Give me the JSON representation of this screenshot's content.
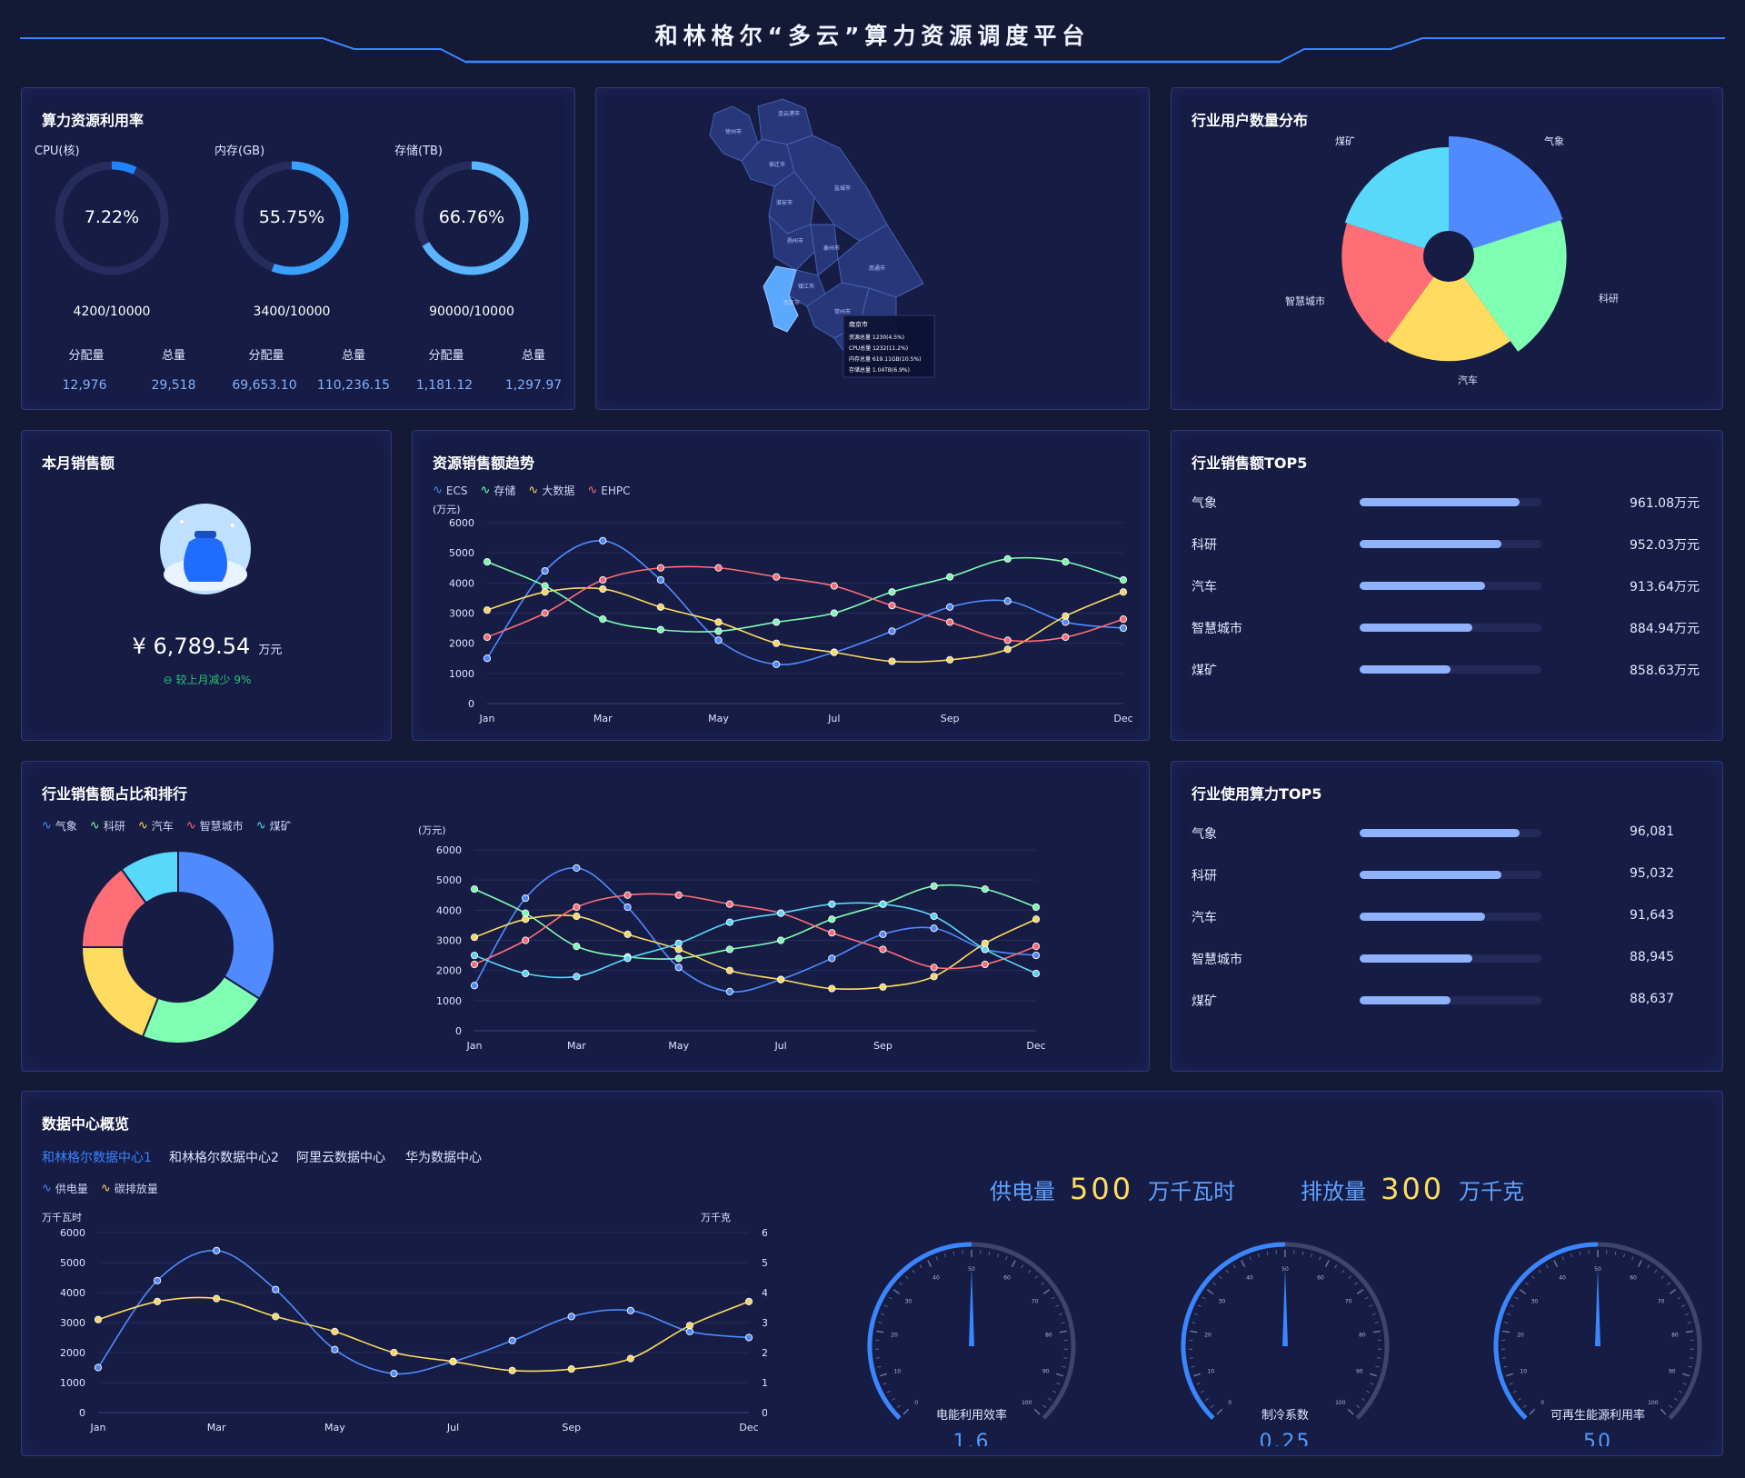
{
  "header": {
    "title": "和林格尔“多云”算力资源调度平台"
  },
  "utilization": {
    "title": "算力资源利用率",
    "items": [
      {
        "label": "CPU(核)",
        "percent": 7.22,
        "percent_text": "7.22%",
        "ratio": "4200/10000",
        "alloc_label": "分配量",
        "total_label": "总量",
        "alloc": "12,976",
        "total": "29,518"
      },
      {
        "label": "内存(GB)",
        "percent": 55.75,
        "percent_text": "55.75%",
        "ratio": "3400/10000",
        "alloc_label": "分配量",
        "total_label": "总量",
        "alloc": "69,653.10",
        "total": "110,236.15"
      },
      {
        "label": "存储(TB)",
        "percent": 66.76,
        "percent_text": "66.76%",
        "ratio": "90000/10000",
        "alloc_label": "分配量",
        "total_label": "总量",
        "alloc": "1,181.12",
        "total": "1,297.97"
      }
    ]
  },
  "map": {
    "cities": [
      "徐州市",
      "连云港市",
      "宿迁市",
      "淮安市",
      "盐城市",
      "扬州市",
      "泰州市",
      "南通市",
      "镇江市",
      "常州市",
      "南京市"
    ],
    "tooltip": {
      "city": "南京市",
      "lines": [
        "资源总量 1230(4.5%)",
        "CPU总量 1232(11.2%)",
        "内存总量 619.11GB(10.5%)",
        "存储总量 1.04TB(6.9%)"
      ]
    }
  },
  "industry_users": {
    "title": "行业用户数量分布",
    "labels": [
      "气象",
      "科研",
      "汽车",
      "智慧城市",
      "煤矿"
    ],
    "colors": {
      "气象": "#4f8bff",
      "科研": "#7effb2",
      "汽车": "#ffdc60",
      "智慧城市": "#ff6e76",
      "煤矿": "#58d9f9"
    }
  },
  "monthly_sales": {
    "title": "本月销售额",
    "amount": "¥ 6,789.54",
    "unit": "万元",
    "compare": "较上月减少 9%"
  },
  "trend": {
    "title": "资源销售额趋势",
    "unit": "(万元)",
    "legend": [
      "ECS",
      "存储",
      "大数据",
      "EHPC"
    ]
  },
  "top5_sales": {
    "title": "行业销售额TOP5",
    "rows": [
      {
        "name": "气象",
        "value": "961.08万元",
        "ratio": 0.88
      },
      {
        "name": "科研",
        "value": "952.03万元",
        "ratio": 0.78
      },
      {
        "name": "汽车",
        "value": "913.64万元",
        "ratio": 0.69
      },
      {
        "name": "智慧城市",
        "value": "884.94万元",
        "ratio": 0.62
      },
      {
        "name": "煤矿",
        "value": "858.63万元",
        "ratio": 0.5
      }
    ]
  },
  "industry_ratio": {
    "title": "行业销售额占比和排行",
    "legend": [
      "气象",
      "科研",
      "汽车",
      "智慧城市",
      "煤矿"
    ],
    "unit": "(万元)"
  },
  "top5_compute": {
    "title": "行业使用算力TOP5",
    "rows": [
      {
        "name": "气象",
        "value": "96,081",
        "ratio": 0.88
      },
      {
        "name": "科研",
        "value": "95,032",
        "ratio": 0.78
      },
      {
        "name": "汽车",
        "value": "91,643",
        "ratio": 0.69
      },
      {
        "name": "智慧城市",
        "value": "88,945",
        "ratio": 0.62
      },
      {
        "name": "煤矿",
        "value": "88,637",
        "ratio": 0.5
      }
    ]
  },
  "datacenter": {
    "title": "数据中心概览",
    "tabs": [
      "和林格尔数据中心1",
      "和林格尔数据中心2",
      "阿里云数据中心",
      "华为数据中心"
    ],
    "active_tab": 0,
    "legend": [
      "供电量",
      "碳排放量"
    ],
    "left_unit": "万千瓦时",
    "right_unit": "万千克",
    "supply_label": "供电量",
    "supply_value": "500",
    "supply_unit": "万千瓦时",
    "emission_label": "排放量",
    "emission_value": "300",
    "emission_unit": "万千克",
    "gauges": [
      {
        "label": "电能利用效率",
        "value_text": "1.6",
        "value": 50
      },
      {
        "label": "制冷系数",
        "value_text": "0.25",
        "value": 50
      },
      {
        "label": "可再生能源利用率",
        "value_text": "50",
        "value": 50
      }
    ],
    "gauge_ticks": [
      "0",
      "10",
      "20",
      "30",
      "40",
      "50",
      "60",
      "70",
      "80",
      "90",
      "100"
    ]
  },
  "chart_data": [
    {
      "type": "pie",
      "title": "行业用户数量分布",
      "labels": [
        "气象",
        "科研",
        "汽车",
        "智慧城市",
        "煤矿"
      ],
      "values": [
        130,
        125,
        95,
        100,
        105
      ]
    },
    {
      "type": "line",
      "title": "资源销售额趋势",
      "categories": [
        "Jan",
        "Feb",
        "Mar",
        "Apr",
        "May",
        "Jun",
        "Jul",
        "Aug",
        "Sep",
        "Oct",
        "Nov",
        "Dec"
      ],
      "xticks": [
        "Jan",
        "Mar",
        "May",
        "Jul",
        "Sep",
        "Dec"
      ],
      "ylabel": "(万元)",
      "ylim": [
        0,
        6000
      ],
      "yticks": [
        0,
        1000,
        2000,
        3000,
        4000,
        5000,
        6000
      ],
      "series": [
        {
          "name": "ECS",
          "color": "#4f8bff",
          "values": [
            1500,
            4400,
            5400,
            4100,
            2100,
            1300,
            1700,
            2400,
            3200,
            3400,
            2700,
            2500
          ]
        },
        {
          "name": "存储",
          "color": "#7effb2",
          "values": [
            4700,
            3900,
            2800,
            2450,
            2400,
            2700,
            3000,
            3700,
            4200,
            4800,
            4700,
            4100
          ]
        },
        {
          "name": "大数据",
          "color": "#ffdc60",
          "values": [
            3100,
            3700,
            3800,
            3200,
            2700,
            2000,
            1700,
            1400,
            1450,
            1800,
            2900,
            3700
          ]
        },
        {
          "name": "EHPC",
          "color": "#ff6e76",
          "values": [
            2200,
            3000,
            4100,
            4500,
            4500,
            4200,
            3900,
            3250,
            2700,
            2100,
            2200,
            2800
          ]
        }
      ]
    },
    {
      "type": "pie",
      "title": "行业销售额占比和排行",
      "labels": [
        "气象",
        "科研",
        "汽车",
        "智慧城市",
        "煤矿"
      ],
      "values": [
        34,
        22,
        19,
        15,
        10
      ]
    },
    {
      "type": "line",
      "title": "行业销售额占比和排行",
      "categories": [
        "Jan",
        "Feb",
        "Mar",
        "Apr",
        "May",
        "Jun",
        "Jul",
        "Aug",
        "Sep",
        "Oct",
        "Nov",
        "Dec"
      ],
      "xticks": [
        "Jan",
        "Mar",
        "May",
        "Jul",
        "Sep",
        "Dec"
      ],
      "ylabel": "(万元)",
      "ylim": [
        0,
        6000
      ],
      "yticks": [
        0,
        1000,
        2000,
        3000,
        4000,
        5000,
        6000
      ],
      "series": [
        {
          "name": "气象",
          "color": "#4f8bff",
          "values": [
            1500,
            4400,
            5400,
            4100,
            2100,
            1300,
            1700,
            2400,
            3200,
            3400,
            2700,
            2500
          ]
        },
        {
          "name": "科研",
          "color": "#7effb2",
          "values": [
            4700,
            3900,
            2800,
            2450,
            2400,
            2700,
            3000,
            3700,
            4200,
            4800,
            4700,
            4100
          ]
        },
        {
          "name": "汽车",
          "color": "#ffdc60",
          "values": [
            3100,
            3700,
            3800,
            3200,
            2700,
            2000,
            1700,
            1400,
            1450,
            1800,
            2900,
            3700
          ]
        },
        {
          "name": "智慧城市",
          "color": "#ff6e76",
          "values": [
            2200,
            3000,
            4100,
            4500,
            4500,
            4200,
            3900,
            3250,
            2700,
            2100,
            2200,
            2800
          ]
        },
        {
          "name": "煤矿",
          "color": "#58d9f9",
          "values": [
            2500,
            1900,
            1800,
            2400,
            2900,
            3600,
            3900,
            4200,
            4200,
            3800,
            2700,
            1900
          ]
        }
      ]
    },
    {
      "type": "line",
      "title": "数据中心概览",
      "categories": [
        "Jan",
        "Feb",
        "Mar",
        "Apr",
        "May",
        "Jun",
        "Jul",
        "Aug",
        "Sep",
        "Oct",
        "Nov",
        "Dec"
      ],
      "xticks": [
        "Jan",
        "Mar",
        "May",
        "Jul",
        "Sep",
        "Dec"
      ],
      "ylim": [
        0,
        6000
      ],
      "yticks": [
        0,
        1000,
        2000,
        3000,
        4000,
        5000,
        6000
      ],
      "series": [
        {
          "name": "供电量",
          "color": "#4f8bff",
          "values": [
            1500,
            4400,
            5400,
            4100,
            2100,
            1300,
            1700,
            2400,
            3200,
            3400,
            2700,
            2500
          ]
        },
        {
          "name": "碳排放量",
          "color": "#ffdc60",
          "values": [
            3100,
            3700,
            3800,
            3200,
            2700,
            2000,
            1700,
            1400,
            1450,
            1800,
            2900,
            3700
          ]
        }
      ]
    }
  ]
}
